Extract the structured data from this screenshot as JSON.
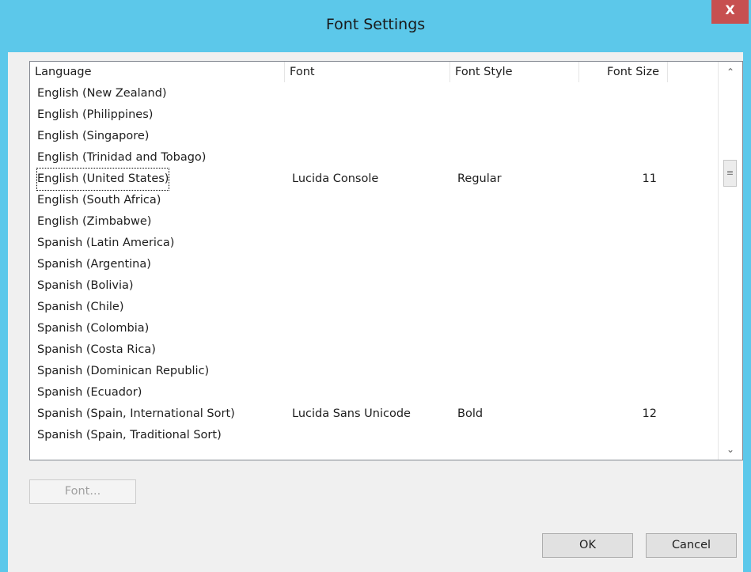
{
  "dialog": {
    "title": "Font Settings",
    "close_label": "X"
  },
  "list": {
    "columns": [
      {
        "label": "Language"
      },
      {
        "label": "Font"
      },
      {
        "label": "Font Style"
      },
      {
        "label": "Font Size"
      }
    ],
    "rows": [
      {
        "language": "English (New Zealand)",
        "font": "",
        "style": "",
        "size": ""
      },
      {
        "language": "English (Philippines)",
        "font": "",
        "style": "",
        "size": ""
      },
      {
        "language": "English (Singapore)",
        "font": "",
        "style": "",
        "size": ""
      },
      {
        "language": "English (Trinidad and Tobago)",
        "font": "",
        "style": "",
        "size": ""
      },
      {
        "language": "English (United States)",
        "font": "Lucida Console",
        "style": "Regular",
        "size": "11"
      },
      {
        "language": "English (South Africa)",
        "font": "",
        "style": "",
        "size": ""
      },
      {
        "language": "English (Zimbabwe)",
        "font": "",
        "style": "",
        "size": ""
      },
      {
        "language": "Spanish (Latin America)",
        "font": "",
        "style": "",
        "size": ""
      },
      {
        "language": "Spanish (Argentina)",
        "font": "",
        "style": "",
        "size": ""
      },
      {
        "language": "Spanish (Bolivia)",
        "font": "",
        "style": "",
        "size": ""
      },
      {
        "language": "Spanish (Chile)",
        "font": "",
        "style": "",
        "size": ""
      },
      {
        "language": "Spanish (Colombia)",
        "font": "",
        "style": "",
        "size": ""
      },
      {
        "language": "Spanish (Costa Rica)",
        "font": "",
        "style": "",
        "size": ""
      },
      {
        "language": "Spanish (Dominican Republic)",
        "font": "",
        "style": "",
        "size": ""
      },
      {
        "language": "Spanish (Ecuador)",
        "font": "",
        "style": "",
        "size": ""
      },
      {
        "language": "Spanish (Spain, International Sort)",
        "font": "Lucida Sans Unicode",
        "style": "Bold",
        "size": "12"
      },
      {
        "language": "Spanish (Spain, Traditional Sort)",
        "font": "",
        "style": "",
        "size": ""
      }
    ],
    "focused_row": 4
  },
  "scrollbar": {
    "up_icon": "chevron-up-icon",
    "down_icon": "chevron-down-icon",
    "thumb_icon": "grip-lines-icon"
  },
  "buttons": {
    "font_label": "Font...",
    "ok_label": "OK",
    "cancel_label": "Cancel"
  },
  "colors": {
    "titlebar": "#5cc8ea",
    "close_button": "#c75050"
  }
}
